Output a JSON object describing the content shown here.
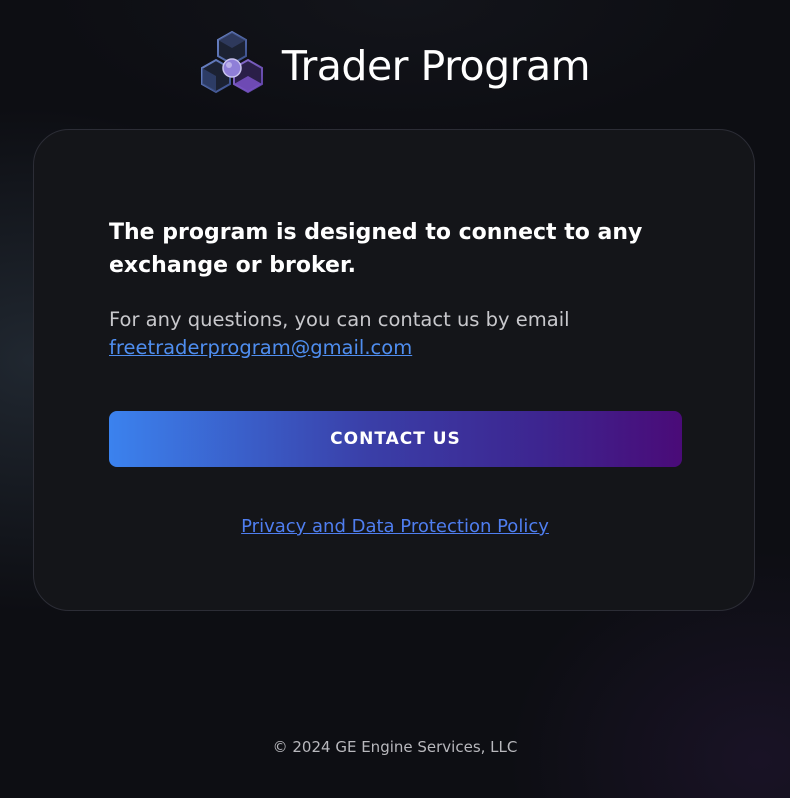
{
  "header": {
    "logo_icon": "cube-cluster-logo-icon",
    "title": "Trader Program"
  },
  "card": {
    "headline": "The program is designed to connect to any exchange or broker.",
    "contact_text": "For any questions, you can contact us by email",
    "email": "freetraderprogram@gmail.com",
    "cta_label": "CONTACT US",
    "policy_link": "Privacy and Data Protection Policy"
  },
  "footer": {
    "copyright": "© 2024 GE Engine Services, LLC"
  },
  "colors": {
    "background": "#0d0e13",
    "card": "#141519",
    "link": "#4f8ef0",
    "cta_start": "#3b82ee",
    "cta_end": "#4a0b78"
  }
}
